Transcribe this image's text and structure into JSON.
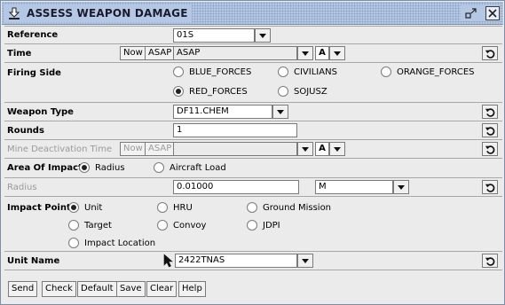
{
  "window": {
    "title": "ASSESS WEAPON DAMAGE"
  },
  "colors": {
    "titlebar": "#b4c8e6",
    "panel": "#ebebeb",
    "border": "#7a8ea8"
  },
  "icons": {
    "window_icon": "down-arrow-icon",
    "restore": "restore-window-icon",
    "close": "close-icon",
    "reset": "undo-icon",
    "dropdown": "chevron-down-icon",
    "pointer": "cursor-pointer-icon"
  },
  "reference": {
    "label": "Reference",
    "value": "01S"
  },
  "time": {
    "label": "Time",
    "now_label": "Now",
    "asap_label": "ASAP",
    "value": "ASAP",
    "unit": "A"
  },
  "firing_side": {
    "label": "Firing Side",
    "options": [
      {
        "label": "BLUE_FORCES",
        "selected": false
      },
      {
        "label": "CIVILIANS",
        "selected": false
      },
      {
        "label": "ORANGE_FORCES",
        "selected": false
      },
      {
        "label": "RED_FORCES",
        "selected": true
      },
      {
        "label": "SOJUSZ",
        "selected": false
      }
    ]
  },
  "weapon_type": {
    "label": "Weapon Type",
    "value": "DF11.CHEM"
  },
  "rounds": {
    "label": "Rounds",
    "value": "1"
  },
  "mine_deactivation_time": {
    "label": "Mine Deactivation Time",
    "now_label": "Now",
    "asap_label": "ASAP",
    "value": "",
    "unit": "A"
  },
  "area_of_impact": {
    "label": "Area Of Impact",
    "options": [
      {
        "label": "Radius",
        "selected": true
      },
      {
        "label": "Aircraft Load",
        "selected": false
      }
    ]
  },
  "radius": {
    "label": "Radius",
    "value": "0.01000",
    "unit": "M"
  },
  "impact_point": {
    "label": "Impact Point",
    "options": [
      {
        "label": "Unit",
        "selected": true
      },
      {
        "label": "HRU",
        "selected": false
      },
      {
        "label": "Ground Mission",
        "selected": false
      },
      {
        "label": "Target",
        "selected": false
      },
      {
        "label": "Convoy",
        "selected": false
      },
      {
        "label": "JDPI",
        "selected": false
      },
      {
        "label": "Impact Location",
        "selected": false
      }
    ]
  },
  "unit_name": {
    "label": "Unit Name",
    "value": "2422TNAS"
  },
  "buttons": {
    "send": "Send",
    "check": "Check",
    "default": "Default",
    "save": "Save",
    "clear": "Clear",
    "help": "Help"
  }
}
